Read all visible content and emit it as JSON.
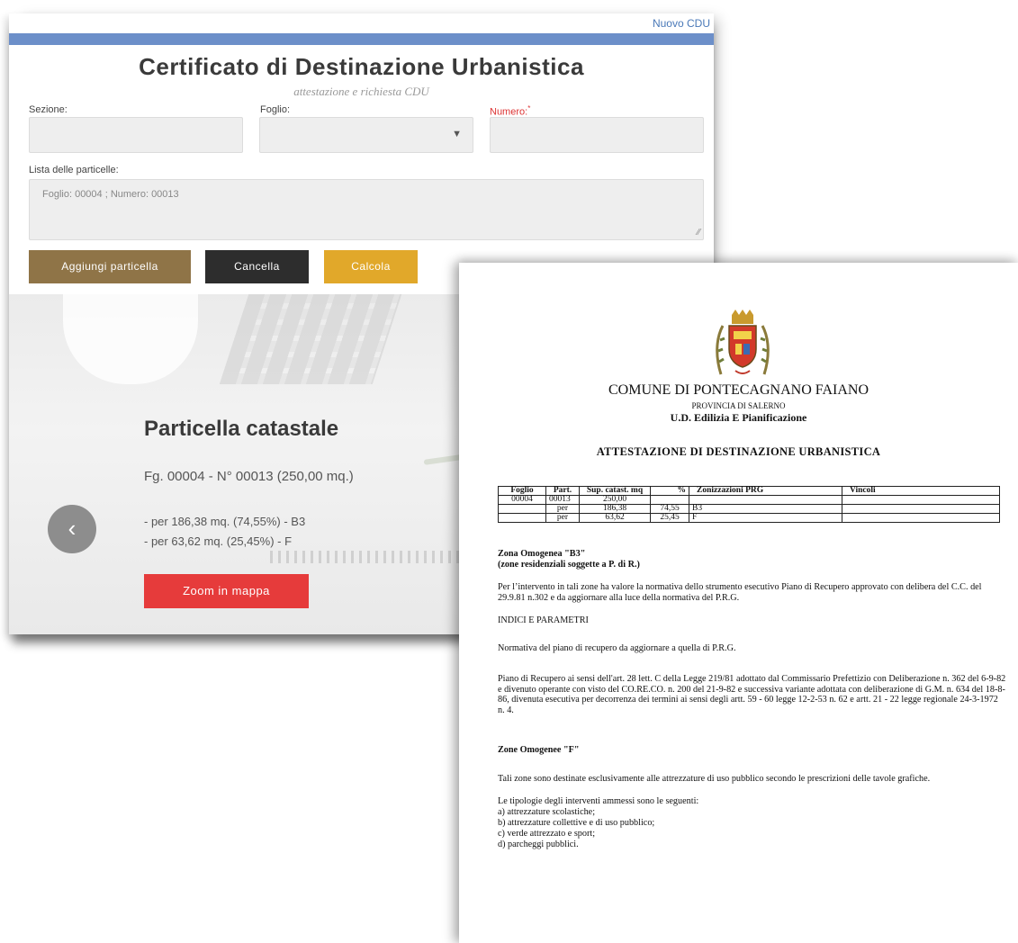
{
  "app": {
    "nuovo_cdu": "Nuovo CDU",
    "title": "Certificato di Destinazione Urbanistica",
    "subtitle": "attestazione e richiesta CDU",
    "fields": {
      "sezione_label": "Sezione:",
      "foglio_label": "Foglio:",
      "numero_label": "Numero:",
      "numero_required_mark": "*"
    },
    "lista": {
      "label": "Lista delle particelle:",
      "value": "Foglio: 00004 ; Numero: 00013"
    },
    "buttons": {
      "aggiungi": "Aggiungi particella",
      "cancella": "Cancella",
      "calcola": "Calcola",
      "zoom": "Zoom in mappa"
    },
    "hero": {
      "title": "Particella catastale",
      "fg_line": "Fg. 00004 - N° 00013 (250,00 mq.)",
      "line1": "- per 186,38 mq. (74,55%) - B3",
      "line2": "- per 63,62 mq. (25,45%) - F",
      "prev_glyph": "‹"
    },
    "colors": {
      "blue_bar": "#6c8fc9",
      "aggiungi": "#8f7447",
      "cancella": "#2d2d2d",
      "calcola": "#e1a82a",
      "zoom": "#e63b3b"
    }
  },
  "document": {
    "comune": "COMUNE DI PONTECAGNANO FAIANO",
    "provincia": "PROVINCIA DI SALERNO",
    "ud": "U.D. Edilizia E Pianificazione",
    "heading": "ATTESTAZIONE DI DESTINAZIONE URBANISTICA",
    "table": {
      "headers": [
        "Foglio",
        "Part.",
        "Sup. catast. mq",
        "%",
        "Zonizzazioni PRG",
        "Vincoli"
      ],
      "rows": [
        [
          "00004",
          "00013",
          "250,00",
          "",
          "",
          ""
        ],
        [
          "",
          "per",
          "186,38",
          "74,55",
          "B3",
          ""
        ],
        [
          "",
          "per",
          "63,62",
          "25,45",
          "F",
          ""
        ]
      ]
    },
    "zona_b3_title": "Zona Omogenea \"B3\"",
    "zona_b3_sub": "(zone residenziali soggette a P. di R.)",
    "para1": "Per l’intervento in tali zone ha valore la normativa dello strumento esecutivo Piano di Recupero approvato con delibera del C.C. del 29.9.81 n.302 e da aggiornare alla luce della normativa del P.R.G.",
    "indici": "INDICI E PARAMETRI",
    "para2": "Normativa del piano di recupero da aggiornare a quella di P.R.G.",
    "para3": "Piano di Recupero ai sensi dell'art. 28 lett. C della Legge 219/81 adottato dal Commissario Prefettizio con Deliberazione n. 362 del 6-9-82 e divenuto operante con visto del CO.RE.CO. n. 200 del 21-9-82 e successiva variante adottata con deliberazione di G.M. n. 634 del 18-8-86, divenuta esecutiva per decorrenza dei termini ai sensi degli artt. 59 - 60 legge 12-2-53 n. 62 e artt. 21 - 22 legge regionale 24-3-1972 n. 4.",
    "zone_f_title": "Zone Omogenee \"F\"",
    "para4": "Tali zone sono destinate esclusivamente alle attrezzature di uso pubblico secondo le prescrizioni delle tavole grafiche.",
    "para5": "Le tipologie degli interventi ammessi sono le seguenti:",
    "list": [
      "a) attrezzature scolastiche;",
      "b) attrezzature collettive e di uso pubblico;",
      "c) verde attrezzato e sport;",
      "d) parcheggi pubblici."
    ]
  }
}
